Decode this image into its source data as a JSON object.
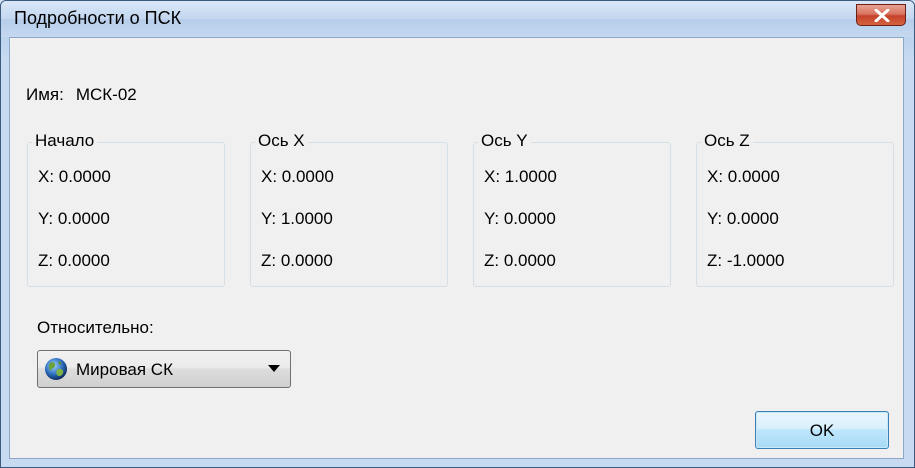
{
  "window": {
    "title": "Подробности о ПСК"
  },
  "name": {
    "label": "Имя:",
    "value": "МСК-02"
  },
  "groups": [
    {
      "title": "Начало",
      "x": "X: 0.0000",
      "y": "Y: 0.0000",
      "z": "Z: 0.0000"
    },
    {
      "title": "Ось X",
      "x": "X: 0.0000",
      "y": "Y: 1.0000",
      "z": "Z: 0.0000"
    },
    {
      "title": "Ось Y",
      "x": "X: 1.0000",
      "y": "Y: 0.0000",
      "z": "Z: 0.0000"
    },
    {
      "title": "Ось Z",
      "x": "X: 0.0000",
      "y": "Y: 0.0000",
      "z": "Z: -1.0000"
    }
  ],
  "relative": {
    "label": "Относительно:",
    "selected": "Мировая СК",
    "icon": "globe-icon"
  },
  "buttons": {
    "ok": "OK"
  },
  "colors": {
    "close_button": "#c4422a",
    "ok_button_border": "#3c7fb1"
  }
}
